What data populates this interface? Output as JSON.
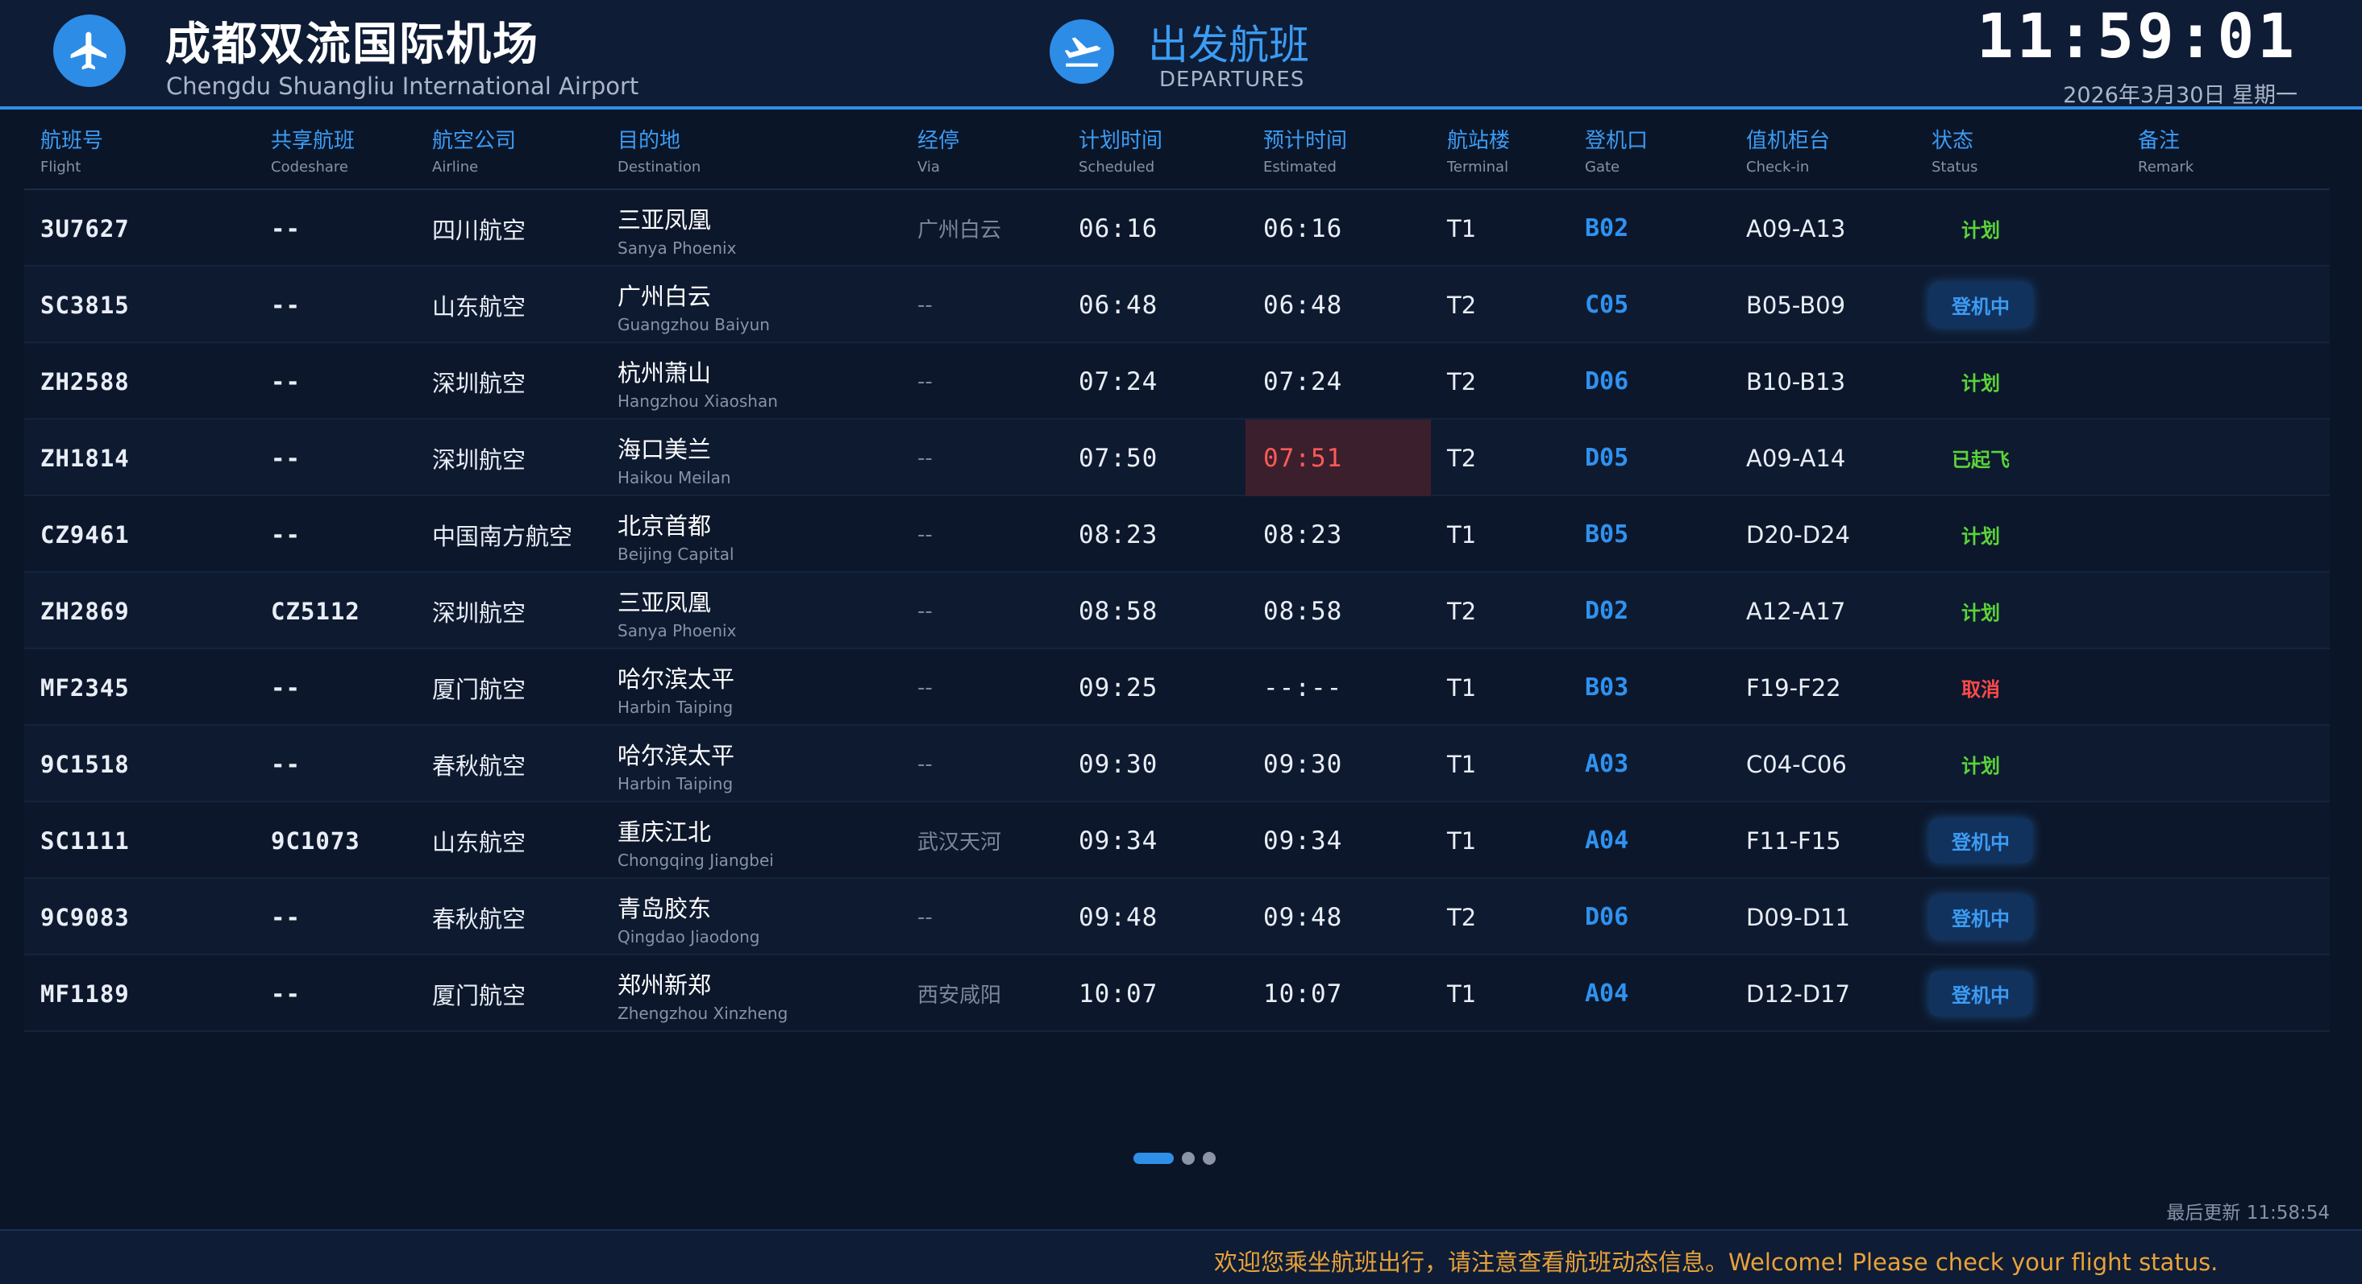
{
  "header": {
    "airport_cn": "成都双流国际机场",
    "airport_en": "Chengdu Shuangliu International Airport",
    "board_cn": "出发航班",
    "board_en": "DEPARTURES",
    "clock": "11:59:01",
    "date": "2026年3月30日 星期一"
  },
  "columns": [
    {
      "cn": "航班号",
      "en": "Flight"
    },
    {
      "cn": "共享航班",
      "en": "Codeshare"
    },
    {
      "cn": "航空公司",
      "en": "Airline"
    },
    {
      "cn": "目的地",
      "en": "Destination"
    },
    {
      "cn": "经停",
      "en": "Via"
    },
    {
      "cn": "计划时间",
      "en": "Scheduled"
    },
    {
      "cn": "预计时间",
      "en": "Estimated"
    },
    {
      "cn": "航站楼",
      "en": "Terminal"
    },
    {
      "cn": "登机口",
      "en": "Gate"
    },
    {
      "cn": "值机柜台",
      "en": "Check-in"
    },
    {
      "cn": "状态",
      "en": "Status"
    },
    {
      "cn": "备注",
      "en": "Remark"
    }
  ],
  "flights": [
    {
      "flight": "3U7627",
      "codeshare": "--",
      "airline": "四川航空",
      "dest_cn": "三亚凤凰",
      "dest_en": "Sanya Phoenix",
      "via": "广州白云",
      "scheduled": "06:16",
      "estimated": "06:16",
      "terminal": "T1",
      "gate": "B02",
      "checkin": "A09-A13",
      "status": "计划",
      "status_type": "plan",
      "delayed": false
    },
    {
      "flight": "SC3815",
      "codeshare": "--",
      "airline": "山东航空",
      "dest_cn": "广州白云",
      "dest_en": "Guangzhou Baiyun",
      "via": "--",
      "scheduled": "06:48",
      "estimated": "06:48",
      "terminal": "T2",
      "gate": "C05",
      "checkin": "B05-B09",
      "status": "登机中",
      "status_type": "boarding",
      "delayed": false
    },
    {
      "flight": "ZH2588",
      "codeshare": "--",
      "airline": "深圳航空",
      "dest_cn": "杭州萧山",
      "dest_en": "Hangzhou Xiaoshan",
      "via": "--",
      "scheduled": "07:24",
      "estimated": "07:24",
      "terminal": "T2",
      "gate": "D06",
      "checkin": "B10-B13",
      "status": "计划",
      "status_type": "plan",
      "delayed": false
    },
    {
      "flight": "ZH1814",
      "codeshare": "--",
      "airline": "深圳航空",
      "dest_cn": "海口美兰",
      "dest_en": "Haikou Meilan",
      "via": "--",
      "scheduled": "07:50",
      "estimated": "07:51",
      "terminal": "T2",
      "gate": "D05",
      "checkin": "A09-A14",
      "status": "已起飞",
      "status_type": "departed",
      "delayed": true
    },
    {
      "flight": "CZ9461",
      "codeshare": "--",
      "airline": "中国南方航空",
      "dest_cn": "北京首都",
      "dest_en": "Beijing Capital",
      "via": "--",
      "scheduled": "08:23",
      "estimated": "08:23",
      "terminal": "T1",
      "gate": "B05",
      "checkin": "D20-D24",
      "status": "计划",
      "status_type": "plan",
      "delayed": false
    },
    {
      "flight": "ZH2869",
      "codeshare": "CZ5112",
      "airline": "深圳航空",
      "dest_cn": "三亚凤凰",
      "dest_en": "Sanya Phoenix",
      "via": "--",
      "scheduled": "08:58",
      "estimated": "08:58",
      "terminal": "T2",
      "gate": "D02",
      "checkin": "A12-A17",
      "status": "计划",
      "status_type": "plan",
      "delayed": false
    },
    {
      "flight": "MF2345",
      "codeshare": "--",
      "airline": "厦门航空",
      "dest_cn": "哈尔滨太平",
      "dest_en": "Harbin Taiping",
      "via": "--",
      "scheduled": "09:25",
      "estimated": "--:--",
      "terminal": "T1",
      "gate": "B03",
      "checkin": "F19-F22",
      "status": "取消",
      "status_type": "cancelled",
      "delayed": false
    },
    {
      "flight": "9C1518",
      "codeshare": "--",
      "airline": "春秋航空",
      "dest_cn": "哈尔滨太平",
      "dest_en": "Harbin Taiping",
      "via": "--",
      "scheduled": "09:30",
      "estimated": "09:30",
      "terminal": "T1",
      "gate": "A03",
      "checkin": "C04-C06",
      "status": "计划",
      "status_type": "plan",
      "delayed": false
    },
    {
      "flight": "SC1111",
      "codeshare": "9C1073",
      "airline": "山东航空",
      "dest_cn": "重庆江北",
      "dest_en": "Chongqing Jiangbei",
      "via": "武汉天河",
      "scheduled": "09:34",
      "estimated": "09:34",
      "terminal": "T1",
      "gate": "A04",
      "checkin": "F11-F15",
      "status": "登机中",
      "status_type": "boarding",
      "delayed": false
    },
    {
      "flight": "9C9083",
      "codeshare": "--",
      "airline": "春秋航空",
      "dest_cn": "青岛胶东",
      "dest_en": "Qingdao Jiaodong",
      "via": "--",
      "scheduled": "09:48",
      "estimated": "09:48",
      "terminal": "T2",
      "gate": "D06",
      "checkin": "D09-D11",
      "status": "登机中",
      "status_type": "boarding",
      "delayed": false
    },
    {
      "flight": "MF1189",
      "codeshare": "--",
      "airline": "厦门航空",
      "dest_cn": "郑州新郑",
      "dest_en": "Zhengzhou Xinzheng",
      "via": "西安咸阳",
      "scheduled": "10:07",
      "estimated": "10:07",
      "terminal": "T1",
      "gate": "A04",
      "checkin": "D12-D17",
      "status": "登机中",
      "status_type": "boarding",
      "delayed": false
    }
  ],
  "status_colors": {
    "plan": "#5ad43a",
    "boarding": "#3b9cf4",
    "departed": "#5ad43a",
    "cancelled": "#ff4a4a",
    "delayed_time": "#ff5a5a"
  },
  "pager": {
    "pages": 3,
    "current": 1
  },
  "footer": {
    "updated": "最后更新 11:58:54",
    "ticker": "欢迎您乘坐航班出行，请注意查看航班动态信息。Welcome! Please check your flight status."
  }
}
